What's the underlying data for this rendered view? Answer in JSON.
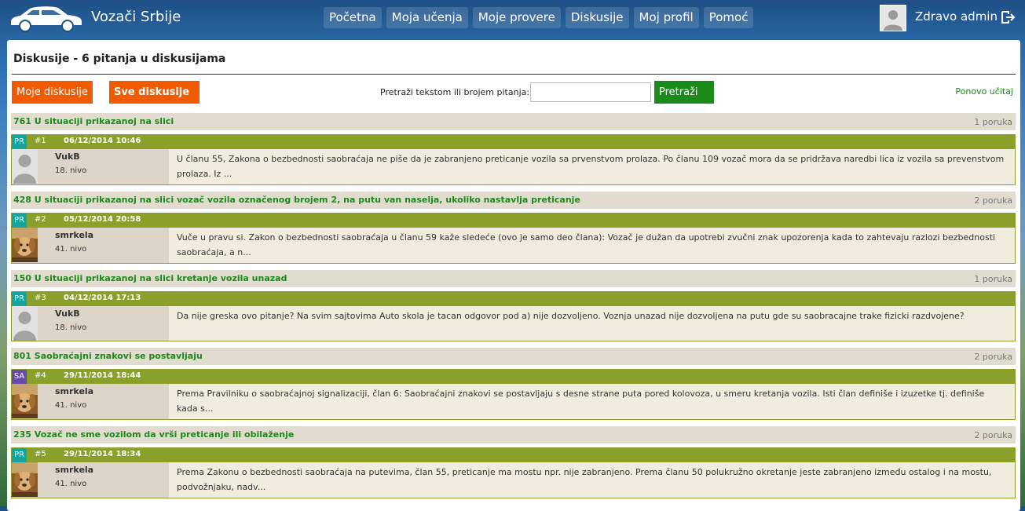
{
  "header": {
    "brand": "Vozači Srbije",
    "nav": [
      "Početna",
      "Moja učenja",
      "Moje provere",
      "Diskusije",
      "Moj profil",
      "Pomoć"
    ],
    "greeting": "Zdravo admin"
  },
  "page": {
    "title": "Diskusije - 6 pitanja u diskusijama",
    "my_discussions": "Moje diskusije",
    "all_discussions": "Sve diskusije",
    "search_label": "Pretraži tekstom ili brojem pitanja:",
    "search_value": "",
    "search_button": "Pretraži",
    "reload": "Ponovo učitaj"
  },
  "colors": {
    "accent_orange": "#f05a00",
    "accent_green": "#1a8a1a",
    "post_header": "#8aa02a",
    "badge_pr": "#14a5a0",
    "badge_sa": "#6a4aa8"
  },
  "discussions": [
    {
      "title": "761 U situaciji prikazanoj na slici",
      "count": "1 poruka",
      "badge": "PR",
      "badge_color": "#14a5a0",
      "num": "#1",
      "date": "06/12/2014 10:46",
      "author": "VukB",
      "level": "18. nivo",
      "avatar": "default",
      "text": "U članu 55, Zakona o bezbednosti saobraćaja ne piše da je zabranjeno preticanje vozila sa prvenstvom prolaza. Po članu 109 vozač mora da se pridržava naredbi lica iz vozila sa prevenstvom prolaza. Iz ..."
    },
    {
      "title": "428 U situaciji prikazanoj na slici vozač vozila  označenog brojem 2, na putu van naselja, ukoliko  nastavlja preticanje",
      "count": "2 poruka",
      "badge": "PR",
      "badge_color": "#14a5a0",
      "num": "#2",
      "date": "05/12/2014 20:58",
      "author": "smrkela",
      "level": "41. nivo",
      "avatar": "dog",
      "text": "Vuče u pravu si. Zakon o bezbednosti saobraćaja u članu 59 kaže sledeće (ovo je samo deo člana): Vozač je dužan da upotrebi zvučni znak upozorenja kada to zahtevaju razlozi bezbednosti saobraćaja, a n..."
    },
    {
      "title": "150 U situaciji prikazanoj na slici kretanje vozila unazad",
      "count": "1 poruka",
      "badge": "PR",
      "badge_color": "#14a5a0",
      "num": "#3",
      "date": "04/12/2014 17:13",
      "author": "VukB",
      "level": "18. nivo",
      "avatar": "default",
      "text": "Da nije greska ovo pitanje? Na svim sajtovima Auto skola je tacan odgovor pod a) nije dozvoljeno. Voznja unazad nije dozvoljena na putu gde su saobracajne trake fizicki razdvojene?"
    },
    {
      "title": "801 Saobraćajni znakovi se postavljaju",
      "count": "2 poruka",
      "badge": "SA",
      "badge_color": "#6a4aa8",
      "num": "#4",
      "date": "29/11/2014 18:44",
      "author": "smrkela",
      "level": "41. nivo",
      "avatar": "dog",
      "text": "Prema Pravilniku o saobraćajnoj signalizaciji, član 6: Saobraćajni znakovi se postavljaju s desne strane puta pored kolovoza, u smeru kretanja vozila. Isti član definiše i izuzetke tj. definiše kada s..."
    },
    {
      "title": "235 Vozač ne sme vozilom da vrši preticanje ili obilaženje",
      "count": "2 poruka",
      "badge": "PR",
      "badge_color": "#14a5a0",
      "num": "#5",
      "date": "29/11/2014 18:34",
      "author": "smrkela",
      "level": "41. nivo",
      "avatar": "dog",
      "text": "Prema Zakonu o bezbednosti saobraćaja na putevima, član 55, preticanje ma mostu npr. nije zabranjeno.  Prema članu 50 polukružno okretanje jeste zabranjeno između ostalog i na mostu, podvožnjaku, nadv..."
    }
  ]
}
